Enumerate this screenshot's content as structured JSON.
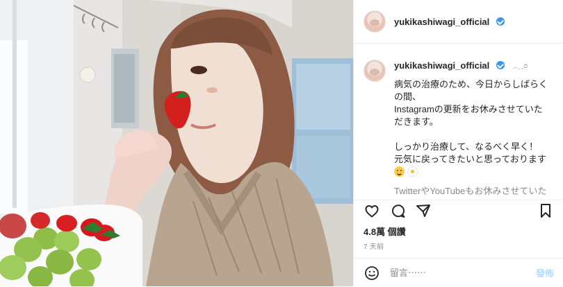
{
  "post": {
    "username": "yukikashiwagi_official",
    "caption": {
      "username": "yukikashiwagi_official",
      "symbol": "𓂃𓈒𓏸",
      "lines": [
        "病気の治療のため、今日からしばらく",
        "の間、",
        "Instagramの更新をお休みさせていた",
        "だきます。",
        "しっかり治療して、なるべく早く！",
        "元気に戻ってきたいと思っております"
      ],
      "clipped_line": "TwitterやYouTubeもお休みさせていた"
    },
    "likes": "4.8萬 個讚",
    "time": "7 天前",
    "comment_placeholder": "留言⋯⋯",
    "post_label": "發佈"
  },
  "icons": {
    "verified": "verified-badge-icon",
    "like": "heart-icon",
    "comment": "comment-icon",
    "share": "share-icon",
    "save": "bookmark-icon",
    "emoji": "emoji-smile-icon"
  },
  "colors": {
    "verified": "#3897f0",
    "text": "#262626",
    "muted": "#8e8e8e",
    "post_disabled": "#b3dbff"
  }
}
